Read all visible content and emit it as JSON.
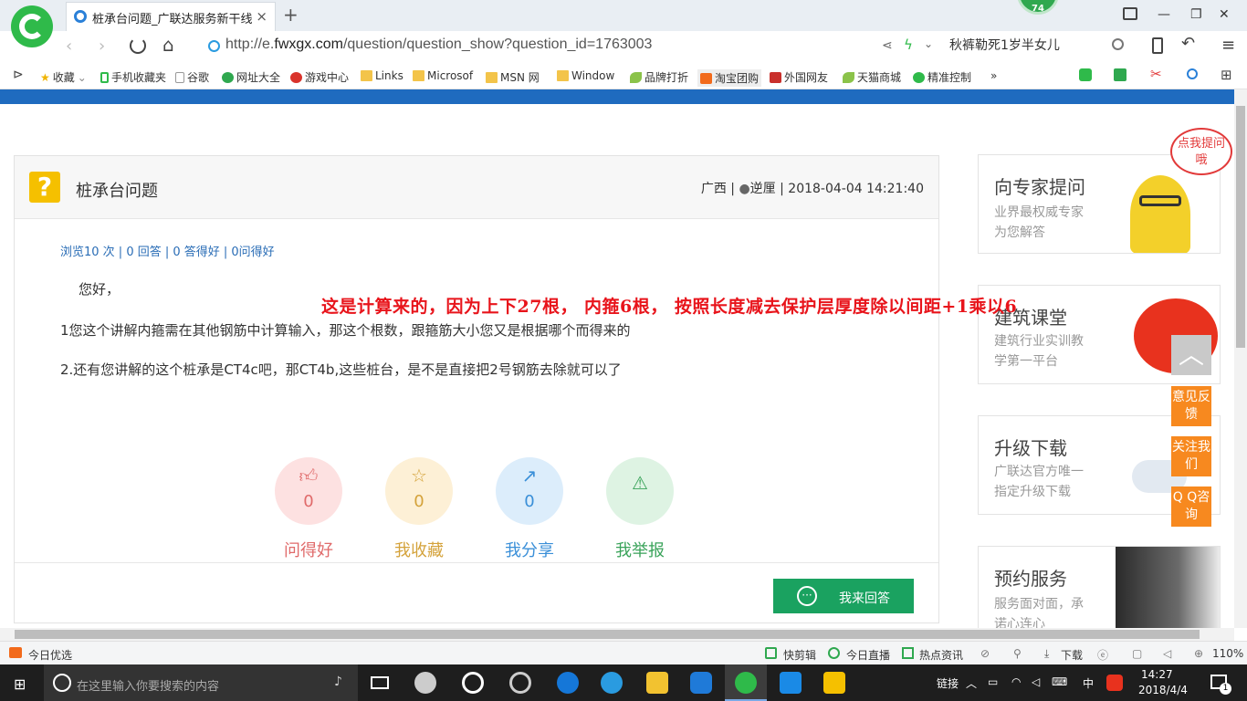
{
  "browser": {
    "tab_title": "桩承台问题_广联达服务新干线",
    "tab_close": "×",
    "new_tab": "+",
    "notify_badge": "74",
    "window_controls": {
      "minimize": "—",
      "maximize": "❐",
      "close": "✕"
    },
    "url_prefix": "http://e.",
    "url_domain": "fwxgx.com",
    "url_path": "/question/question_show?question_id=1763003",
    "search_query": "秋裤勒死1岁半女儿",
    "bookmarks": [
      "收藏",
      "手机收藏夹",
      "谷歌",
      "网址大全",
      "游戏中心",
      "Links",
      "Microsof",
      "MSN 网",
      "Window",
      "品牌打折",
      "淘宝团购",
      "外国网友",
      "天猫商城",
      "精准控制"
    ],
    "bookmarks_more": "»"
  },
  "question": {
    "title": "桩承台问题",
    "region": "广西",
    "sep1": "|",
    "user": "逆厘",
    "sep2": "|",
    "datetime": "2018-04-04 14:21:40",
    "stats": "浏览10 次 | 0 回答 | 0 答得好 | 0问得好",
    "greeting": "您好，",
    "line1": "1您这个讲解内箍需在其他钢筋中计算输入，那这个根数，跟箍筋大小您又是根据哪个而得来的",
    "line2": "2.还有您讲解的这个桩承是CT4c吧，那CT4b,这些桩台，是不是直接把2号钢筋去除就可以了"
  },
  "actions": [
    {
      "label": "问得好",
      "count": "0",
      "color": "#e06a6a",
      "bg": "#fde1e1"
    },
    {
      "label": "我收藏",
      "count": "0",
      "color": "#d4a23a",
      "bg": "#fdf0d6"
    },
    {
      "label": "我分享",
      "count": "0",
      "color": "#3a8fd8",
      "bg": "#dcedfb"
    },
    {
      "label": "我举报",
      "count": "",
      "color": "#3aa35a",
      "bg": "#def3e3"
    }
  ],
  "answer_button": "我来回答",
  "annotation": "这是计算来的，因为上下27根， 内箍6根， 按照长度减去保护层厚度除以间距+1乘以6",
  "sidebar": {
    "bubble": "点我提问哦",
    "cards": [
      {
        "title": "向专家提问",
        "sub1": "业界最权威专家",
        "sub2": "为您解答"
      },
      {
        "title": "建筑课堂",
        "sub1": "建筑行业实训教",
        "sub2": "学第一平台"
      },
      {
        "title": "升级下载",
        "sub1": "广联达官方唯一",
        "sub2": "指定升级下载"
      },
      {
        "title": "预约服务",
        "sub1": "服务面对面，承",
        "sub2": "诺心连心"
      }
    ],
    "float_buttons": [
      "意见反馈",
      "关注我们",
      "Q Q咨询"
    ]
  },
  "statusbar": {
    "left": "今日优选",
    "items": [
      "快剪辑",
      "今日直播",
      "热点资讯",
      "下载"
    ],
    "zoom": "110%"
  },
  "taskbar": {
    "search_placeholder": "在这里输入你要搜索的内容",
    "tray_label": "链接",
    "ime": "中",
    "time": "14:27",
    "date": "2018/4/4",
    "notifications": "1"
  }
}
